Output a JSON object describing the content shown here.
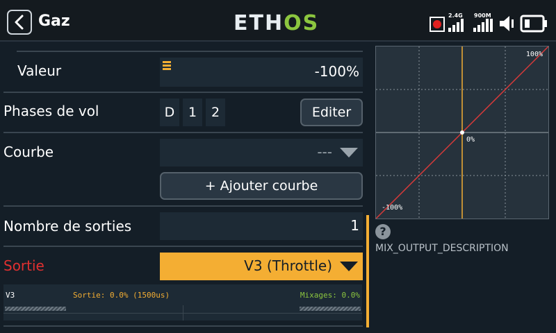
{
  "header": {
    "title": "Gaz",
    "logo_left": "ETH",
    "logo_right": "OS",
    "rssi_24_label": "2.4G",
    "rssi_900_label": "900M"
  },
  "form": {
    "valeur": {
      "label": "Valeur",
      "value": "-100%"
    },
    "phases": {
      "label": "Phases de vol",
      "items": [
        "D",
        "1",
        "2"
      ],
      "edit_button": "Editer"
    },
    "courbe": {
      "label": "Courbe",
      "value": "---",
      "add_button": "+ Ajouter courbe"
    },
    "nombre_sorties": {
      "label": "Nombre de sorties",
      "value": "1"
    },
    "sortie": {
      "label": "Sortie",
      "value": "V3 (Throttle)"
    }
  },
  "output_monitor": {
    "channel": "V3",
    "sortie_text": "Sortie: 0.0% (1500us)",
    "mixages_text": "Mixages: 0.0%"
  },
  "graph": {
    "top_label": "100%",
    "center_label": "0%",
    "bottom_label": "-100%"
  },
  "help": {
    "icon": "?",
    "description": "MIX_OUTPUT_DESCRIPTION"
  },
  "colors": {
    "accent_orange": "#f4ae33",
    "brand_green": "#8cc63f",
    "sortie_label_red": "#e03030",
    "curve_red": "#d83a3a"
  },
  "chart_data": {
    "type": "line",
    "x": [
      -100,
      0,
      100
    ],
    "series": [
      {
        "values": [
          -100,
          0,
          100
        ]
      }
    ],
    "xlim": [
      -100,
      100
    ],
    "ylim": [
      -100,
      100
    ],
    "grid": true
  }
}
